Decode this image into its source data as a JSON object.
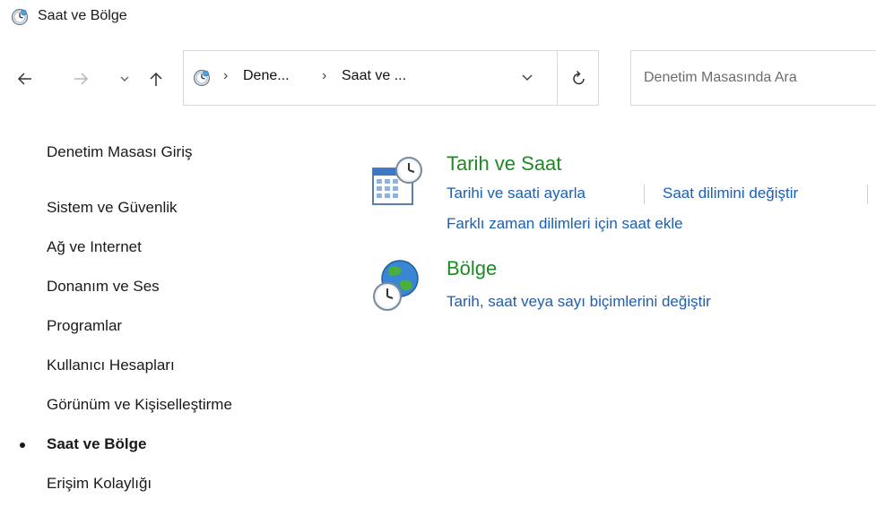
{
  "window": {
    "title": "Saat ve Bölge",
    "title_icon": "control-panel-clock-icon"
  },
  "navigation": {
    "back_icon": "back-arrow-icon",
    "forward_icon": "forward-arrow-icon",
    "recent_icon": "chevron-down-icon",
    "up_icon": "up-arrow-icon"
  },
  "address_bar": {
    "icon": "control-panel-clock-icon",
    "separator": "›",
    "crumbs": [
      "Dene...",
      "Saat ve ..."
    ],
    "dropdown_icon": "chevron-down-icon",
    "refresh_icon": "refresh-icon"
  },
  "search": {
    "placeholder": "Denetim Masasında Ara"
  },
  "sidebar": {
    "home": "Denetim Masası Giriş",
    "items": [
      "Sistem ve Güvenlik",
      "Ağ ve Internet",
      "Donanım ve Ses",
      "Programlar",
      "Kullanıcı Hesapları",
      "Görünüm ve Kişiselleştirme",
      "Saat ve Bölge",
      "Erişim Kolaylığı"
    ],
    "active_index": 6
  },
  "sections": [
    {
      "title": "Tarih ve Saat",
      "icon": "calendar-clock-icon",
      "links": [
        "Tarihi ve saati ayarla",
        "Saat dilimini değiştir",
        "Farklı zaman dilimleri için saat ekle"
      ]
    },
    {
      "title": "Bölge",
      "icon": "globe-clock-icon",
      "links": [
        "Tarih, saat veya sayı biçimlerini değiştir"
      ]
    }
  ],
  "colors": {
    "heading": "#1e8a24",
    "link": "#1a5fb4",
    "text": "#1a1a1a"
  }
}
